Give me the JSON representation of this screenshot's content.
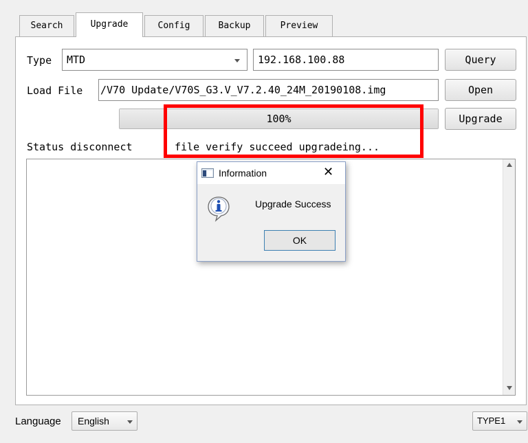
{
  "tabs": [
    {
      "label": "Search"
    },
    {
      "label": "Upgrade"
    },
    {
      "label": "Config"
    },
    {
      "label": "Backup"
    },
    {
      "label": "Preview"
    }
  ],
  "active_tab": "Upgrade",
  "form": {
    "type_label": "Type",
    "type_value": "MTD",
    "ip_value": "192.168.100.88",
    "query_label": "Query",
    "load_file_label": "Load File",
    "file_path": "/V70 Update/V70S_G3.V_V7.2.40_24M_20190108.img",
    "open_label": "Open",
    "progress_text": "100%",
    "progress_value": 100,
    "upgrade_label": "Upgrade",
    "status_label": "Status",
    "status_connection": "disconnect",
    "status_message": "file verify succeed upgradeing..."
  },
  "dialog": {
    "title": "Information",
    "message": "Upgrade Success",
    "ok_label": "OK",
    "close_glyph": "✕",
    "icon": "info-icon"
  },
  "footer": {
    "language_label": "Language",
    "language_value": "English",
    "type_value": "TYPE1"
  },
  "colors": {
    "highlight": "#ff0000",
    "info_icon": "#1e50b4"
  }
}
